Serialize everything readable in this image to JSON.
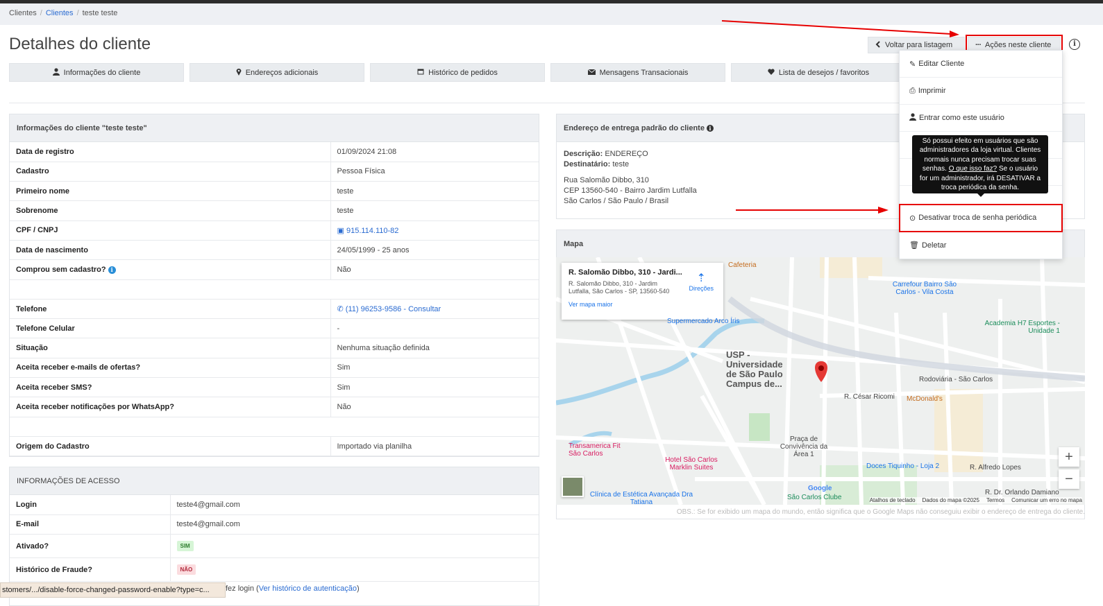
{
  "breadcrumb": {
    "items": [
      "Clientes",
      "Clientes",
      "teste teste"
    ]
  },
  "page_title": "Detalhes do cliente",
  "header_buttons": {
    "back": "Voltar para listagem",
    "actions": "Ações neste cliente"
  },
  "tabs": [
    "Informações do cliente",
    "Endereços adicionais",
    "Histórico de pedidos",
    "Mensagens Transacionais",
    "Lista de desejos / favoritos"
  ],
  "client_panel": {
    "title": "Informações do cliente \"teste teste\"",
    "rows": [
      {
        "k": "Data de registro",
        "v": "01/09/2024 21:08"
      },
      {
        "k": "Cadastro",
        "v": "Pessoa Física"
      },
      {
        "k": "Primeiro nome",
        "v": "teste"
      },
      {
        "k": "Sobrenome",
        "v": "teste"
      },
      {
        "k": "CPF / CNPJ",
        "v": "915.114.110-82"
      },
      {
        "k": "Data de nascimento",
        "v": "24/05/1999 - 25 anos"
      },
      {
        "k": "Comprou sem cadastro?",
        "v": "Não"
      },
      {
        "k": "Telefone",
        "v": "(11) 96253-9586 - Consultar"
      },
      {
        "k": "Telefone Celular",
        "v": "-"
      },
      {
        "k": "Situação",
        "v": "Nenhuma situação definida"
      },
      {
        "k": "Aceita receber e-mails de ofertas?",
        "v": "Sim"
      },
      {
        "k": "Aceita receber SMS?",
        "v": "Sim"
      },
      {
        "k": "Aceita receber notificações por WhatsApp?",
        "v": "Não"
      },
      {
        "k": "Origem do Cadastro",
        "v": "Importado via planilha"
      }
    ]
  },
  "access_panel": {
    "title": "INFORMAÇÕES DE ACESSO",
    "rows": [
      {
        "k": "Login",
        "v": "teste4@gmail.com"
      },
      {
        "k": "E-mail",
        "v": "teste4@gmail.com"
      },
      {
        "k": "Ativado?",
        "v": "SIM"
      },
      {
        "k": "Histórico de Fraude?",
        "v": "NÃO"
      }
    ],
    "last_login_tail": "fez login",
    "auth_history_link": "Ver histórico de autenticação"
  },
  "address_panel": {
    "title": "Endereço de entrega padrão do cliente",
    "desc_label": "Descrição:",
    "desc_value": "ENDEREÇO",
    "dest_label": "Destinatário:",
    "dest_value": "teste",
    "line1": "Rua Salomão Dibbo, 310",
    "line2": "CEP 13560-540 - Bairro Jardim Lutfalla",
    "line3": "São Carlos / São Paulo / Brasil"
  },
  "map_panel": {
    "title": "Mapa",
    "card_title": "R. Salomão Dibbo, 310 - Jardi...",
    "card_sub": "R. Salomão Dibbo, 310 - Jardim Lutfalla, São Carlos - SP, 13560-540",
    "card_dir": "Direções",
    "card_more": "Ver mapa maior",
    "labels": [
      "Supermercado Arco Íris",
      "USP - Universidade de São Paulo Campus de...",
      "Carrefour Bairro São Carlos - Vila Costa",
      "Academia H7 Esportes - Unidade 1",
      "Rodoviária - São Carlos",
      "McDonald's",
      "R. César Ricomi",
      "Praça de Convivência da Área 1",
      "Doces Tiquinho - Loja 2",
      "Hotel São Carlos Marklin Suites",
      "Transamerica Fit São Carlos",
      "Clínica de Estética Avançada Dra Tatiana",
      "São Carlos Clube",
      "R. Alfredo Lopes",
      "R. Dr. Orlando Damiano",
      "Cafeteria",
      "Google"
    ],
    "footer": [
      "Atalhos de teclado",
      "Dados do mapa ©2025",
      "Termos",
      "Comunicar um erro no mapa"
    ],
    "obs": "OBS.: Se for exibido um mapa do mundo, então significa que o Google Maps não conseguiu exibir o endereço de entrega do cliente."
  },
  "dropdown": {
    "items": [
      "Editar Cliente",
      "Imprimir",
      "Entrar como este usuário",
      "",
      "",
      "",
      "Desativar troca de senha periódica",
      "Deletar"
    ]
  },
  "tooltip": {
    "text1": "Só possui efeito em usuários que são administradores da loja virtual. Clientes normais nunca precisam trocar suas senhas.",
    "link": "O que isso faz?",
    "text2": " Se o usuário for um administrador, irá DESATIVAR a troca periódica da senha."
  },
  "statusbar": "stomers/.../disable-force-changed-password-enable?type=c...",
  "colors": {
    "accent": "#2a6bd1",
    "highlight": "#e60000",
    "panel_head": "#eef0f3"
  }
}
